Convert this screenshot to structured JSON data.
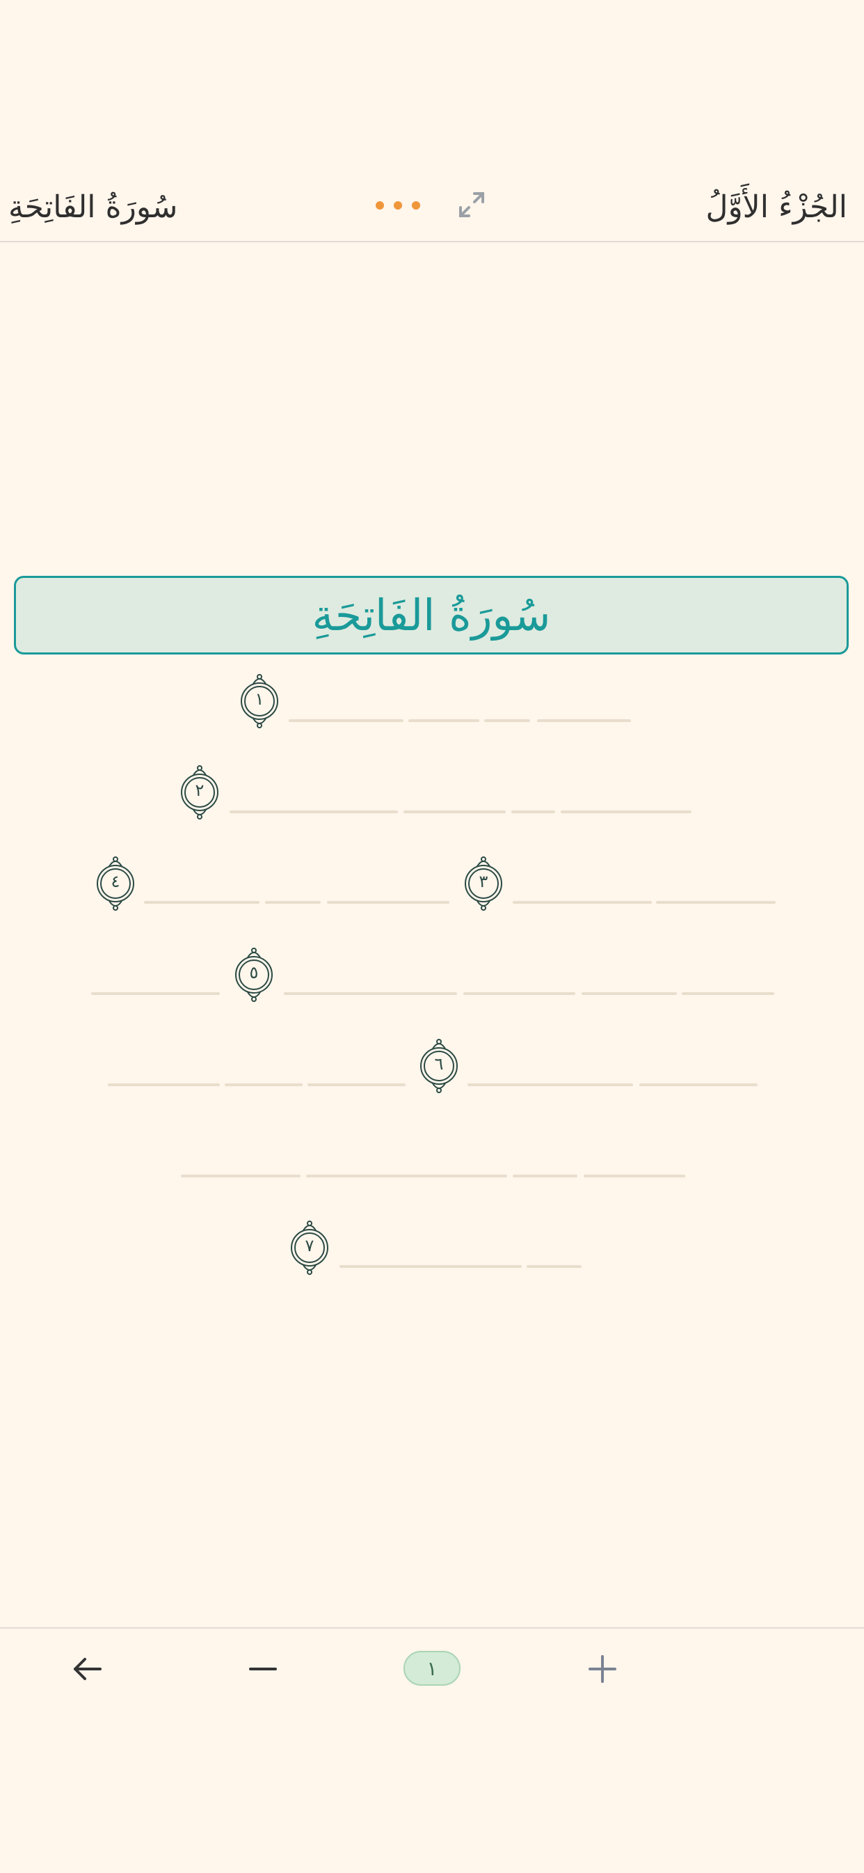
{
  "header": {
    "juz_title": "الجُزْءُ الأَوَّلُ",
    "surah_title": "سُورَةُ الفَاتِحَةِ"
  },
  "banner": {
    "surah_name": "سُورَةُ الفَاتِحَةِ"
  },
  "ayah_markers": [
    "١",
    "٢",
    "٣",
    "٤",
    "٥",
    "٦",
    "٧"
  ],
  "icons": {
    "more": "more-dots-icon",
    "expand": "expand-icon",
    "back": "arrow-left-icon",
    "zoom_out": "minus-icon",
    "zoom_in": "plus-icon",
    "ayah_marker": "ayah-ornament-icon"
  },
  "footer": {
    "page_number": "١"
  },
  "colors": {
    "background": "#fff6ec",
    "accent_teal": "#1a9a99",
    "banner_fill": "#dfebe0",
    "more_orange": "#f0963a",
    "placeholder_line": "#e9decc",
    "page_badge": "#d3ebd7"
  }
}
